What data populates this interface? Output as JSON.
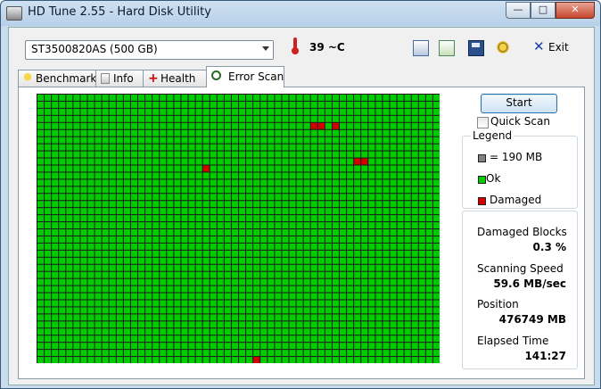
{
  "window": {
    "title": "HD Tune 2.55 - Hard Disk Utility"
  },
  "toolbar": {
    "drive": "ST3500820AS (500 GB)",
    "temperature": "39 ~C",
    "exit_label": "Exit",
    "icons": [
      "copy-text-icon",
      "copy-screenshot-icon",
      "save-icon",
      "options-icon",
      "exit-icon"
    ]
  },
  "tabs": [
    {
      "label": "Benchmark",
      "icon": "benchmark-icon",
      "active": false
    },
    {
      "label": "Info",
      "icon": "info-icon",
      "active": false
    },
    {
      "label": "Health",
      "icon": "health-icon",
      "active": false
    },
    {
      "label": "Error Scan",
      "icon": "magnifier-icon",
      "active": true
    }
  ],
  "scan": {
    "start_label": "Start",
    "quick_scan_label": "Quick Scan",
    "quick_scan_checked": false,
    "legend": {
      "title": "Legend",
      "block_size": "= 190 MB",
      "ok": "Ok",
      "damaged": "Damaged"
    },
    "colors": {
      "ok": "#00cc00",
      "damaged": "#d40000",
      "block": "#808080",
      "grid_line": "#1a1a1a"
    },
    "grid": {
      "columns": 56,
      "rows": 38
    },
    "damaged_blocks": [
      {
        "row": 4,
        "col": 38
      },
      {
        "row": 4,
        "col": 39
      },
      {
        "row": 4,
        "col": 41
      },
      {
        "row": 9,
        "col": 44
      },
      {
        "row": 9,
        "col": 45
      },
      {
        "row": 10,
        "col": 23
      },
      {
        "row": 37,
        "col": 30
      }
    ]
  },
  "stats": {
    "damaged_blocks_label": "Damaged Blocks",
    "damaged_blocks_value": "0.3 %",
    "speed_label": "Scanning Speed",
    "speed_value": "59.6 MB/sec",
    "position_label": "Position",
    "position_value": "476749 MB",
    "elapsed_label": "Elapsed Time",
    "elapsed_value": "141:27"
  }
}
